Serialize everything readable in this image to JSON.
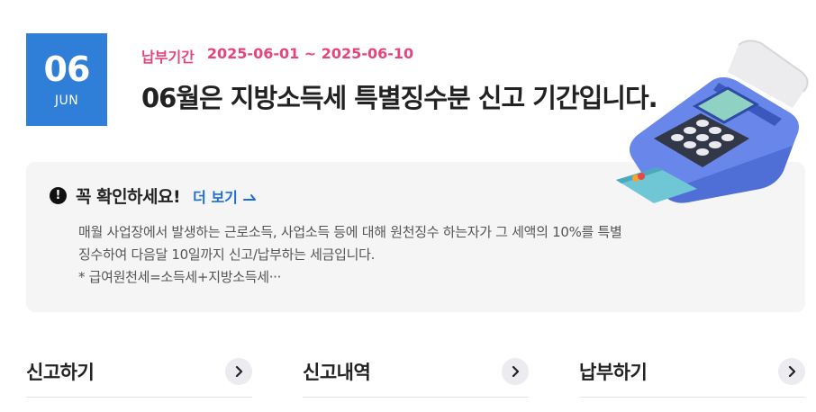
{
  "date_badge": {
    "day": "06",
    "month": "JUN"
  },
  "period": {
    "label": "납부기간",
    "range": "2025-06-01 ~ 2025-06-10"
  },
  "headline": "06월은 지방소득세 특별징수분 신고 기간입니다.",
  "notice": {
    "title": "꼭 확인하세요!",
    "more_label": "더 보기",
    "lines": [
      "매월 사업장에서 발생하는 근로소득, 사업소득 등에 대해 원천징수 하는자가 그 세액의 10%를 특별",
      "징수하여 다음달 10일까지 신고/납부하는 세금입니다.",
      "* 급여원천세=소득세+지방소득세···"
    ]
  },
  "nav": [
    {
      "label": "신고하기"
    },
    {
      "label": "신고내역"
    },
    {
      "label": "납부하기"
    }
  ],
  "colors": {
    "accent_blue": "#2f7fd8",
    "period_pink": "#e6457a",
    "link_blue": "#1a6ed8",
    "box_bg": "#f5f5f5"
  },
  "icons": {
    "warning": "exclamation-circle-icon",
    "more": "arrow-up-right-icon",
    "nav": "chevron-right-icon",
    "illustration": "card-terminal-illustration"
  }
}
